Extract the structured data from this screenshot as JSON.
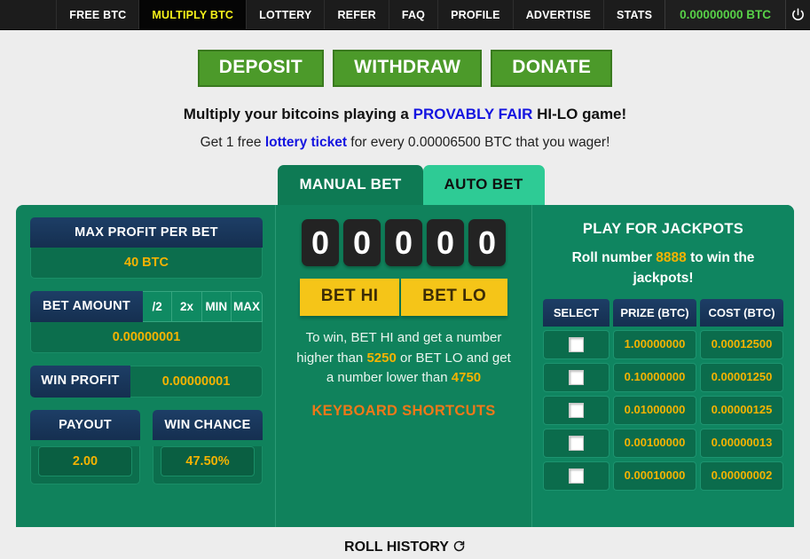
{
  "nav": {
    "items": [
      {
        "label": "FREE BTC",
        "active": false
      },
      {
        "label": "MULTIPLY BTC",
        "active": true
      },
      {
        "label": "LOTTERY",
        "active": false
      },
      {
        "label": "REFER",
        "active": false
      },
      {
        "label": "FAQ",
        "active": false
      },
      {
        "label": "PROFILE",
        "active": false
      },
      {
        "label": "ADVERTISE",
        "active": false
      },
      {
        "label": "STATS",
        "active": false
      }
    ],
    "balance": "0.00000000 BTC",
    "power_icon": "power-icon",
    "accent_active": "#f5f11a",
    "balance_color": "#58d148"
  },
  "actions": {
    "deposit": "DEPOSIT",
    "withdraw": "WITHDRAW",
    "donate": "DONATE",
    "color": "#4c9a2a"
  },
  "headings": {
    "line1_a": "Multiply your bitcoins playing a ",
    "line1_link": "PROVABLY FAIR",
    "line1_b": " HI-LO game!",
    "line2_a": "Get 1 free ",
    "line2_link": "lottery ticket",
    "line2_b": " for every 0.00006500 BTC that you wager!",
    "link_color": "#1414e0"
  },
  "tabs": {
    "manual": "MANUAL BET",
    "auto": "AUTO BET",
    "active": "MANUAL BET"
  },
  "left_panel": {
    "max_profit_label": "MAX PROFIT PER BET",
    "max_profit_value": "40 BTC",
    "bet_amount_label": "BET AMOUNT",
    "bet_amount_buttons": [
      "/2",
      "2x",
      "MIN",
      "MAX"
    ],
    "bet_amount_value": "0.00000001",
    "win_profit_label": "WIN PROFIT",
    "win_profit_value": "0.00000001",
    "payout_label": "PAYOUT",
    "payout_value": "2.00",
    "win_chance_label": "WIN CHANCE",
    "win_chance_value": "47.50%"
  },
  "center_panel": {
    "digits": [
      "0",
      "0",
      "0",
      "0",
      "0"
    ],
    "bet_hi": "BET HI",
    "bet_lo": "BET LO",
    "hint_a": "To win, BET HI and get a number higher than ",
    "hint_hi": "5250",
    "hint_b": " or BET LO and get a number lower than ",
    "hint_lo": "4750",
    "shortcuts": "KEYBOARD SHORTCUTS",
    "shortcuts_color": "#f07818"
  },
  "jackpot": {
    "title": "PLAY FOR JACKPOTS",
    "sub_a": "Roll number ",
    "sub_number": "8888",
    "sub_b": " to win the jackpots!",
    "columns": [
      "SELECT",
      "PRIZE (BTC)",
      "COST (BTC)"
    ],
    "rows": [
      {
        "prize": "1.00000000",
        "cost": "0.00012500"
      },
      {
        "prize": "0.10000000",
        "cost": "0.00001250"
      },
      {
        "prize": "0.01000000",
        "cost": "0.00000125"
      },
      {
        "prize": "0.00100000",
        "cost": "0.00000013"
      },
      {
        "prize": "0.00010000",
        "cost": "0.00000002"
      }
    ]
  },
  "footer": {
    "roll_history": "ROLL HISTORY",
    "refresh_icon": "refresh-icon"
  }
}
